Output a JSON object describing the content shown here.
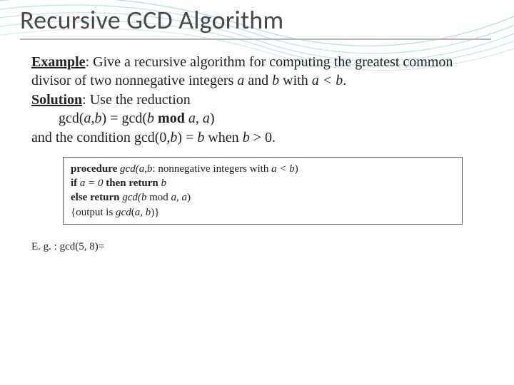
{
  "title": "Recursive GCD Algorithm",
  "example": {
    "label": "Example",
    "text_lead": ": Give a recursive algorithm for computing the greatest common divisor of two nonnegative integers ",
    "var_a": "a",
    "and": " and ",
    "var_b": "b",
    "with": " with ",
    "cond": "a < b",
    "period": "."
  },
  "solution": {
    "label": "Solution",
    "text_lead": ": Use the reduction",
    "eq_lhs": "gcd(",
    "eq_a": "a",
    "eq_c1": ",",
    "eq_b": "b",
    "eq_rparen_eq": ") = gcd(",
    "eq_b2": "b",
    "eq_sp": " ",
    "mod": "mod",
    "eq_a2": " a",
    "eq_c2": ", ",
    "eq_a3": "a",
    "eq_rend": ")",
    "cond_text1": "and the condition gcd(0,",
    "cond_b": "b",
    "cond_text2": ") = ",
    "cond_b2": "b",
    "cond_text3": " when ",
    "cond_b3": "b",
    "cond_gt": " > 0."
  },
  "code": {
    "kw_proc": "procedure",
    "proc_sig1": " gcd(",
    "proc_a": "a",
    "proc_c1": ",",
    "proc_b": "b",
    "proc_sig2": ": nonnegative integers  with ",
    "proc_cond": "a < b",
    "proc_rp": ")",
    "kw_if": "if ",
    "if_cond": " a = 0 ",
    "kw_then_return": "then return ",
    "if_ret": "b",
    "kw_else": "else ",
    "kw_return": "return ",
    "else_sig1": " gcd(",
    "else_b": "b",
    "else_mod": " mod ",
    "else_a": "a",
    "else_c": ", ",
    "else_a2": "a",
    "else_rp": ")",
    "comment1": "{output is ",
    "comment_g": "gcd",
    "comment_lp": "(",
    "comment_a": "a",
    "comment_c": ", ",
    "comment_b": "b",
    "comment_rp": ")}"
  },
  "eg": {
    "label": "E. g. : gcd(5, 8)="
  }
}
